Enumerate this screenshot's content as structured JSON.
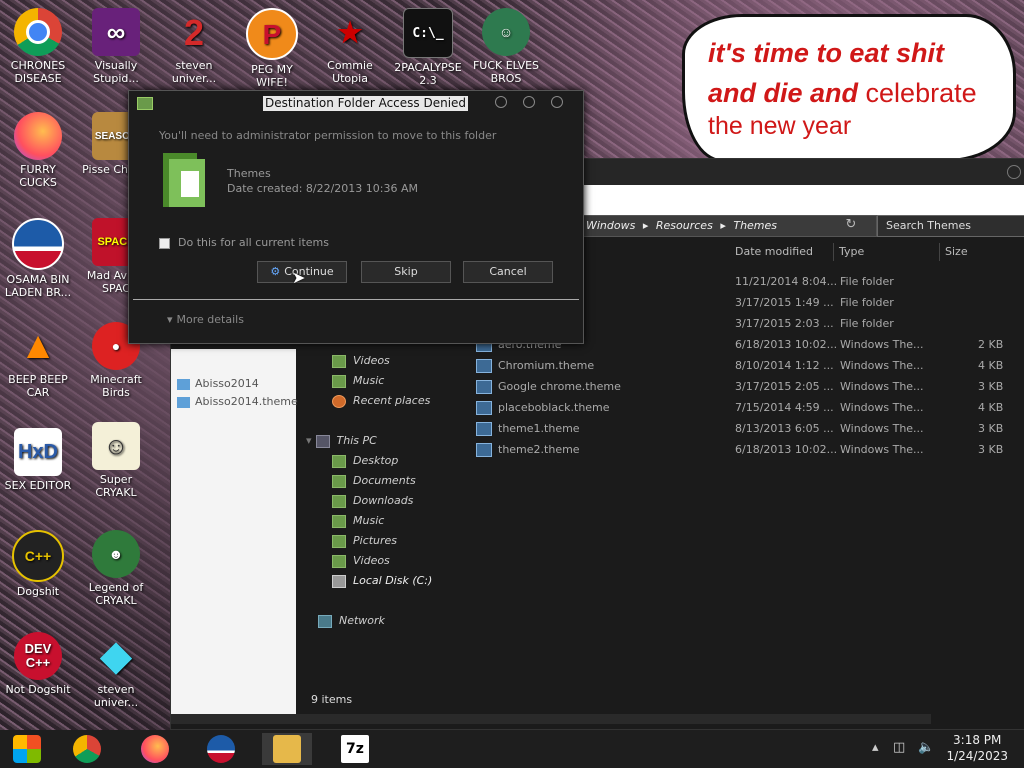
{
  "desktop": {
    "icons": [
      {
        "label": "CHRONES DISEASE",
        "icon": "chrome-icon"
      },
      {
        "label": "Visually Stupid...",
        "icon": "visual-studio-icon"
      },
      {
        "label": "steven univer...",
        "icon": "steven-universe-icon"
      },
      {
        "label": "PEG MY WIFE!",
        "icon": "p-badge-icon"
      },
      {
        "label": "Commie Utopia",
        "icon": "emblem-icon"
      },
      {
        "label": "2PACALYPSE 2.3",
        "icon": "terminal-icon"
      },
      {
        "label": "FUCK ELVES BROS",
        "icon": "mario-icon"
      },
      {
        "label": "FURRY CUCKS",
        "icon": "firefox-icon"
      },
      {
        "label": "Pisse Chicke",
        "icon": "game-icon"
      },
      {
        "label": "OSAMA BIN LADEN BR...",
        "icon": "obama-logo-icon"
      },
      {
        "label": "Mad Avi IN SPAC",
        "icon": "angry-birds-space-icon"
      },
      {
        "label": "BEEP BEEP CAR",
        "icon": "vlc-icon"
      },
      {
        "label": "Minecraft Birds",
        "icon": "angry-birds-icon"
      },
      {
        "label": "SEX EDITOR",
        "icon": "hxd-icon"
      },
      {
        "label": "Super CRYAKL",
        "icon": "cat-icon"
      },
      {
        "label": "Dogshit",
        "icon": "codeblocks-icon"
      },
      {
        "label": "Legend of CRYAKL",
        "icon": "character-icon"
      },
      {
        "label": "Not Dogshit",
        "icon": "dev-cpp-icon"
      },
      {
        "label": "steven univer...",
        "icon": "diamond-icon"
      }
    ],
    "meme": {
      "line1": "it's time to eat shit",
      "line2_bold": "and die and",
      "line2_normal": " celebrate",
      "line3": "the new year"
    }
  },
  "dialog": {
    "title": "Destination Folder Access Denied",
    "message": "You'll need to administrator permission to move to this folder",
    "folder_name": "Themes",
    "date_created": "Date created: 8/22/2013 10:36 AM",
    "checkbox_label": "Do this for all current items",
    "continue_label": "Continue",
    "skip_label": "Skip",
    "cancel_label": "Cancel",
    "more_details": "More details"
  },
  "explorer": {
    "breadcrumb": [
      "Windows",
      "Resources",
      "Themes"
    ],
    "search_placeholder": "Search Themes",
    "columns": {
      "date": "Date modified",
      "type": "Type",
      "size": "Size"
    },
    "files": [
      {
        "name": "",
        "date": "11/21/2014 8:04...",
        "type": "File folder",
        "size": ""
      },
      {
        "name": "",
        "date": "3/17/2015 1:49 ...",
        "type": "File folder",
        "size": ""
      },
      {
        "name": "",
        "date": "3/17/2015 2:03 ...",
        "type": "File folder",
        "size": ""
      },
      {
        "name": "aero.theme",
        "date": "6/18/2013 10:02...",
        "type": "Windows The...",
        "size": "2 KB"
      },
      {
        "name": "Chromium.theme",
        "date": "8/10/2014 1:12 ...",
        "type": "Windows The...",
        "size": "4 KB"
      },
      {
        "name": "Google chrome.theme",
        "date": "3/17/2015 2:05 ...",
        "type": "Windows The...",
        "size": "3 KB"
      },
      {
        "name": "placeboblack.theme",
        "date": "7/15/2014 4:59 ...",
        "type": "Windows The...",
        "size": "4 KB"
      },
      {
        "name": "theme1.theme",
        "date": "8/13/2013 6:05 ...",
        "type": "Windows The...",
        "size": "3 KB"
      },
      {
        "name": "theme2.theme",
        "date": "6/18/2013 10:02...",
        "type": "Windows The...",
        "size": "3 KB"
      }
    ],
    "nav": {
      "videos_top": "Videos",
      "music_top": "Music",
      "recent": "Recent places",
      "this_pc": "This PC",
      "desktop": "Desktop",
      "documents": "Documents",
      "downloads": "Downloads",
      "music": "Music",
      "pictures": "Pictures",
      "videos": "Videos",
      "local_disk": "Local Disk (C:)",
      "network": "Network"
    },
    "left_pane": [
      "Abisso2014",
      "Abisso2014.theme"
    ],
    "status": "9 items"
  },
  "taskbar": {
    "time": "3:18 PM",
    "date": "1/24/2023",
    "apps": [
      "windows-logo-icon",
      "chrome-icon",
      "firefox-icon",
      "obama-logo-icon",
      "file-explorer-icon",
      "7zip-icon"
    ],
    "seven_zip_label": "7z"
  }
}
